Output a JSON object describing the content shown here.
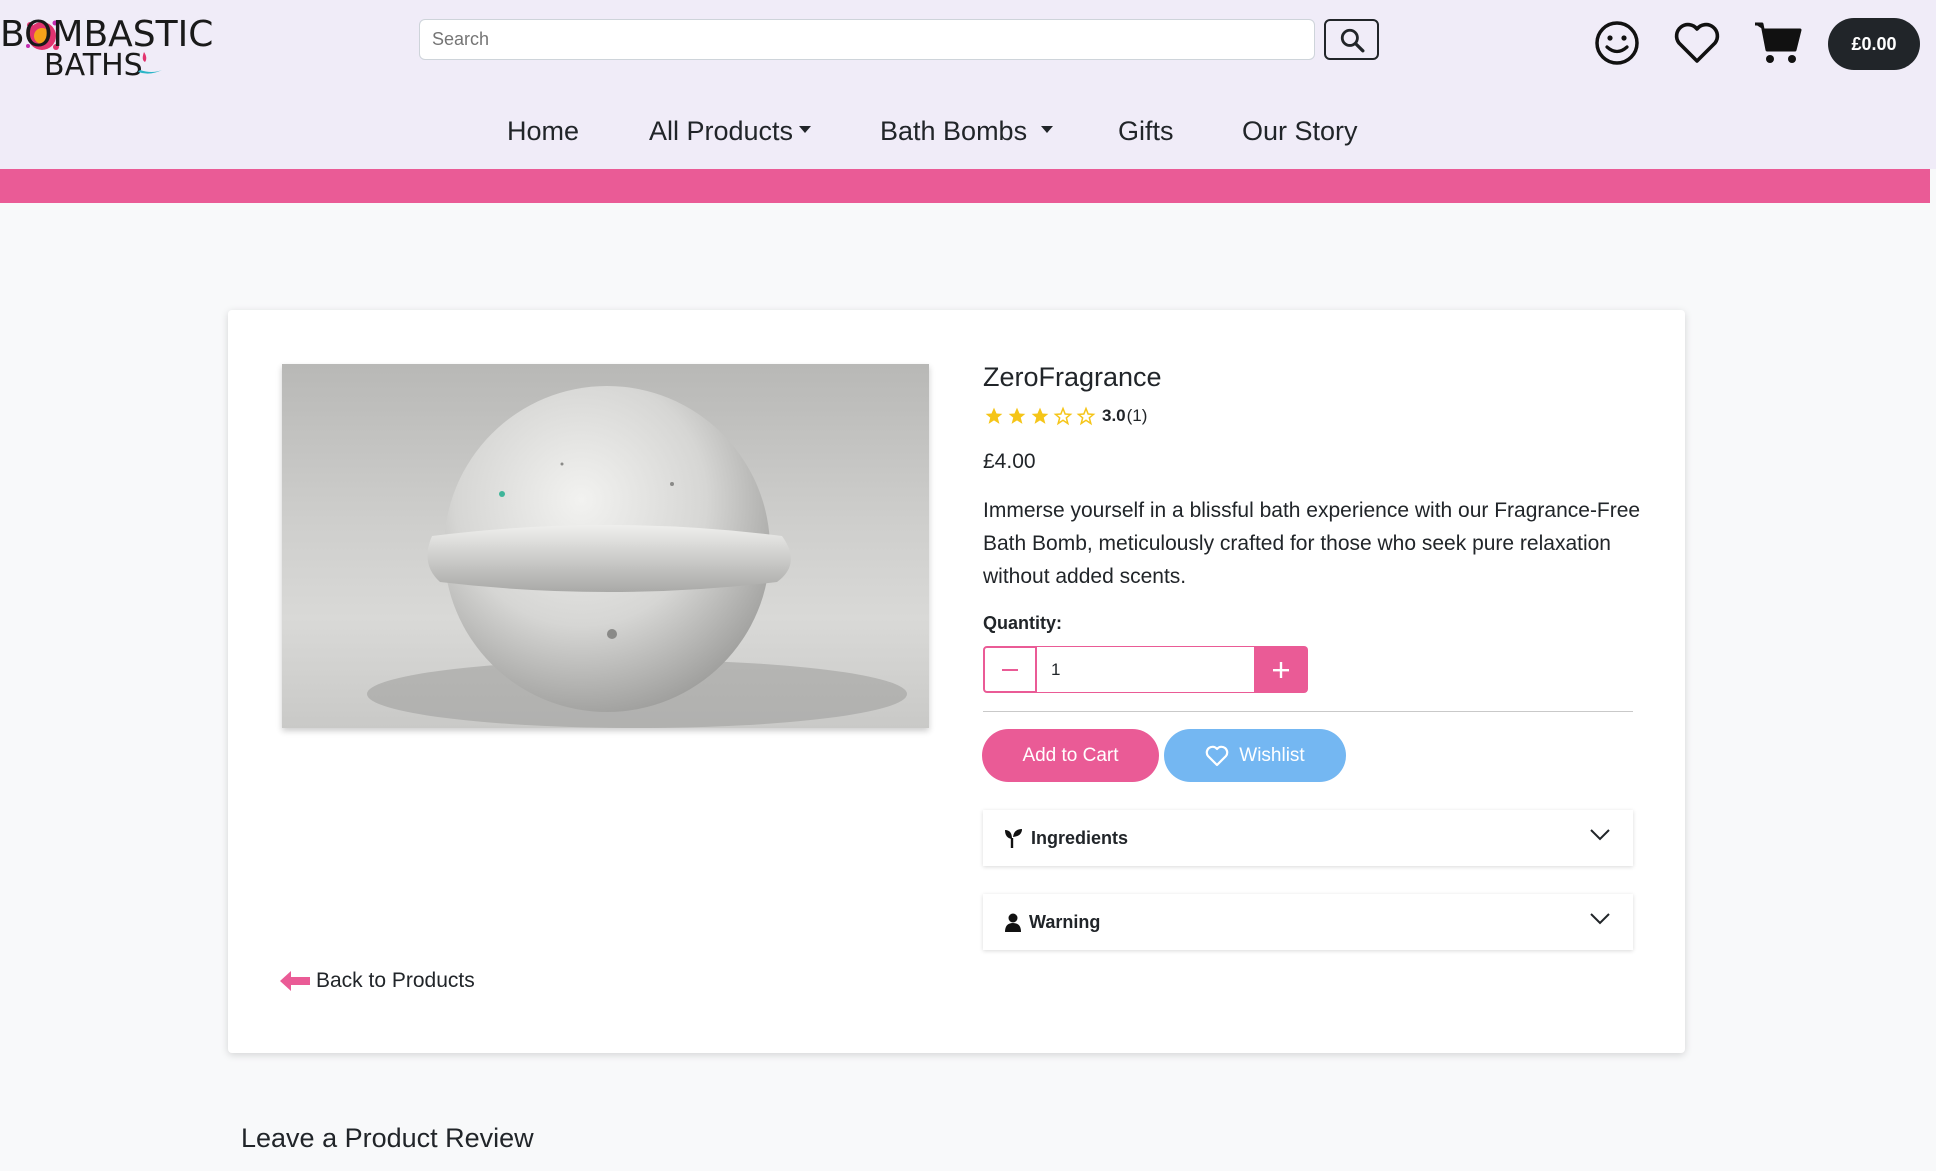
{
  "header": {
    "logo_line1": "BOMBASTIC",
    "logo_line2": "BATHS",
    "search_placeholder": "Search",
    "cart_total": "£0.00",
    "icons": [
      "search-icon",
      "smiley-icon",
      "heart-icon",
      "cart-icon"
    ]
  },
  "nav": {
    "items": [
      {
        "label": "Home"
      },
      {
        "label": "All Products",
        "dropdown": true
      },
      {
        "label": "Bath Bombs",
        "dropdown": true
      },
      {
        "label": "Gifts"
      },
      {
        "label": "Our Story"
      }
    ]
  },
  "product": {
    "title": "ZeroFragrance",
    "rating": "3.0",
    "rating_value": 3,
    "rating_max": 5,
    "review_count": "(1)",
    "price": "£4.00",
    "description": "Immerse yourself in a blissful bath experience with our Fragrance-Free Bath Bomb, meticulously crafted for those who seek pure relaxation without added scents.",
    "quantity_label": "Quantity:",
    "quantity_value": "1",
    "add_to_cart_label": "Add to Cart",
    "wishlist_label": "Wishlist",
    "accordions": [
      {
        "title": "Ingredients",
        "icon": "sprout-icon"
      },
      {
        "title": "Warning",
        "icon": "person-icon"
      }
    ],
    "back_link": "Back to Products"
  },
  "review": {
    "heading": "Leave a Product Review"
  },
  "colors": {
    "accent_pink": "#ea5b96",
    "wishlist_blue": "#74b7f2",
    "header_bg": "#f0ecf8",
    "star_gold": "#f5c518",
    "dark": "#212529"
  }
}
